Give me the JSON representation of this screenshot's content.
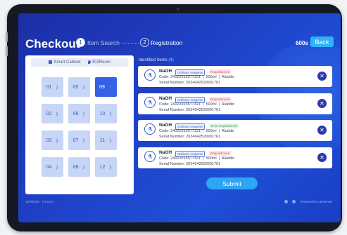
{
  "header": {
    "title": "Checkout",
    "steps": [
      {
        "num": "1",
        "label": "Item Search"
      },
      {
        "num": "2",
        "label": "Registration"
      }
    ],
    "timer": "600s",
    "back_label": "Back"
  },
  "cabinet": {
    "name": "Smart Cabinet",
    "room": "302Room",
    "drawers": [
      "01",
      "05",
      "09",
      "02",
      "06",
      "10",
      "03",
      "07",
      "11",
      "04",
      "08",
      "12"
    ],
    "selected": "09"
  },
  "items_panel": {
    "title": "Identified Items",
    "count": "(4)"
  },
  "items": [
    {
      "name": "NaOH",
      "category": "Ordinary reagents",
      "status": "Requisitioned",
      "code_label": "Code:",
      "code": "24022915577321",
      "volume": "500ml",
      "vendor": "Aladdin",
      "serial_label": "Serial Number:",
      "serial": "2024042529901761"
    },
    {
      "name": "NaOH",
      "category": "Ordinary reagents",
      "status": "Requisitioned",
      "code_label": "Code:",
      "code": "24022915577321",
      "volume": "500ml",
      "vendor": "Aladdin",
      "serial_label": "Serial Number:",
      "serial": "2024042529901761"
    },
    {
      "name": "NaOH",
      "category": "Ordinary reagents",
      "status": "To be requisitioned",
      "code_label": "Code:",
      "code": "24022915577321",
      "volume": "500ml",
      "vendor": "Aladdin",
      "serial_label": "Serial Number:",
      "serial": "2024042529901761"
    },
    {
      "name": "NaOH",
      "category": "Ordinary reagents",
      "status": "Requisitioned",
      "code_label": "Code:",
      "code": "24022915577321",
      "volume": "500ml",
      "vendor": "Aladdin",
      "serial_label": "Serial Number:",
      "serial": "2024042529901761"
    }
  ],
  "submit_label": "Submit",
  "footer": {
    "version": "VERSION : V1.0.0.1",
    "powered": "Powered by LabServer"
  },
  "colors": {
    "accent": "#2fb2f8",
    "screen_bg": "#1f42c8",
    "requisitioned": "#e35a5a",
    "to_be_requisitioned": "#37a55a"
  }
}
